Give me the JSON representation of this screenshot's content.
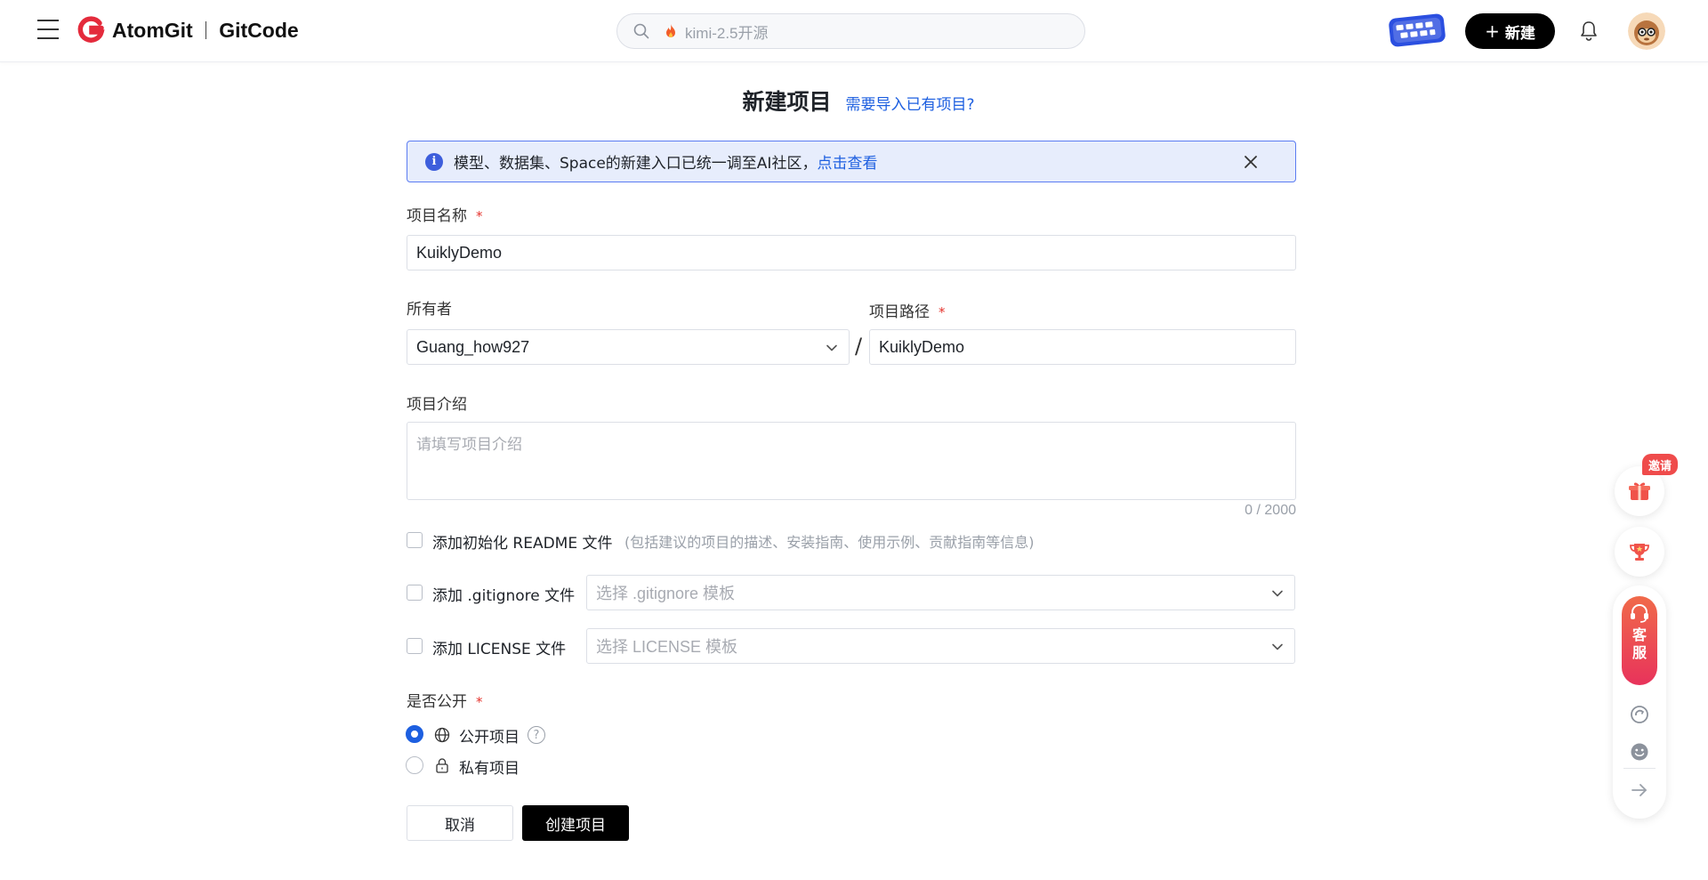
{
  "header": {
    "logo_brand": "AtomGit",
    "logo_product": "GitCode",
    "search_placeholder": "kimi-2.5开源",
    "new_button_label": "新建"
  },
  "page": {
    "title": "新建项目",
    "import_link": "需要导入已有项目?"
  },
  "alert": {
    "message": "模型、数据集、Space的新建入口已统一调至AI社区，",
    "link": "点击查看"
  },
  "form": {
    "project_name_label": "项目名称",
    "project_name_value": "KuiklyDemo",
    "required_mark": "*",
    "owner_label": "所有者",
    "owner_value": "Guang_how927",
    "path_separator": "/",
    "path_label": "项目路径",
    "path_value": "KuiklyDemo",
    "intro_label": "项目介绍",
    "intro_placeholder": "请填写项目介绍",
    "intro_counter": "0 / 2000",
    "readme_label": "添加初始化 README 文件",
    "readme_hint": "(包括建议的项目的描述、安装指南、使用示例、贡献指南等信息)",
    "gitignore_label": "添加 .gitignore 文件",
    "gitignore_placeholder": "选择 .gitignore 模板",
    "license_label": "添加 LICENSE 文件",
    "license_placeholder": "选择 LICENSE 模板",
    "visibility_label": "是否公开",
    "public_label": "公开项目",
    "private_label": "私有项目",
    "help_mark": "?",
    "visibility_selected": "public"
  },
  "actions": {
    "cancel_label": "取消",
    "create_label": "创建项目"
  },
  "floating": {
    "invite_tag": "邀请",
    "customer_service": "客服"
  },
  "colors": {
    "accent": "#1d5fe0",
    "primary_button": "#000000",
    "required": "#e5332d",
    "alert_bg": "#e7edfc",
    "cs_gradient_top": "#f06a4a",
    "cs_gradient_bottom": "#e8335b"
  },
  "icons": [
    "menu-icon",
    "atomgit-logo-icon",
    "search-icon",
    "fire-icon",
    "bell-icon",
    "info-icon",
    "close-icon",
    "chevron-down-icon",
    "globe-icon",
    "lock-icon",
    "help-icon",
    "gift-icon",
    "trophy-icon",
    "headset-icon",
    "refresh-icon",
    "smile-icon",
    "arrow-right-icon"
  ]
}
